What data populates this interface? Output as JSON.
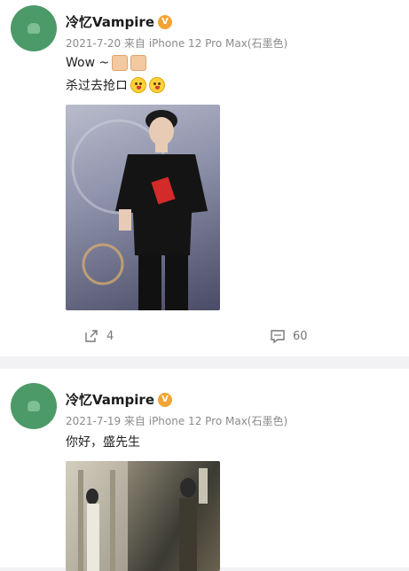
{
  "posts": [
    {
      "username": "冷忆Vampire",
      "meta": "2021-7-20  来自 iPhone 12 Pro Max(石墨色)",
      "line1_text": "Wow ~",
      "line2_text": "杀过去抢ロ",
      "share_count": "4",
      "comment_count": "60"
    },
    {
      "username": "冷忆Vampire",
      "meta": "2021-7-19  来自 iPhone 12 Pro Max(石墨色)",
      "line1_text": "你好，盛先生"
    }
  ]
}
